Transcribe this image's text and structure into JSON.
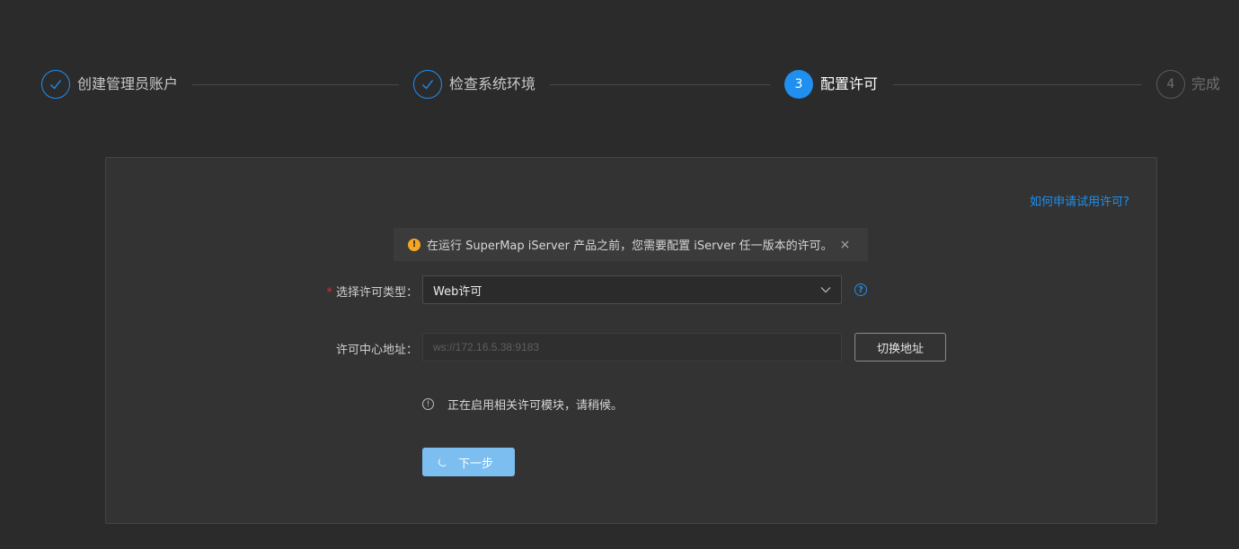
{
  "steps": [
    {
      "number": "1",
      "title": "创建管理员账户",
      "status": "done"
    },
    {
      "number": "2",
      "title": "检查系统环境",
      "status": "done"
    },
    {
      "number": "3",
      "title": "配置许可",
      "status": "active"
    },
    {
      "number": "4",
      "title": "完成",
      "status": "wait"
    }
  ],
  "help_link": "如何申请试用许可?",
  "alert": {
    "message": "在运行 SuperMap iServer 产品之前，您需要配置 iServer 任一版本的许可。",
    "close": "×"
  },
  "form": {
    "license_type_label": "选择许可类型：",
    "license_type_value": "Web许可",
    "license_center_label": "许可中心地址：",
    "license_center_placeholder": "ws://172.16.5.38:9183",
    "switch_button": "切换地址"
  },
  "status_message": "正在启用相关许可模块，请稍候。",
  "next_button": "下一步",
  "colors": {
    "primary": "#1f8ff0",
    "background": "#2b2b2b",
    "card": "#333333",
    "warning": "#f5a623",
    "required": "#f5222d"
  }
}
